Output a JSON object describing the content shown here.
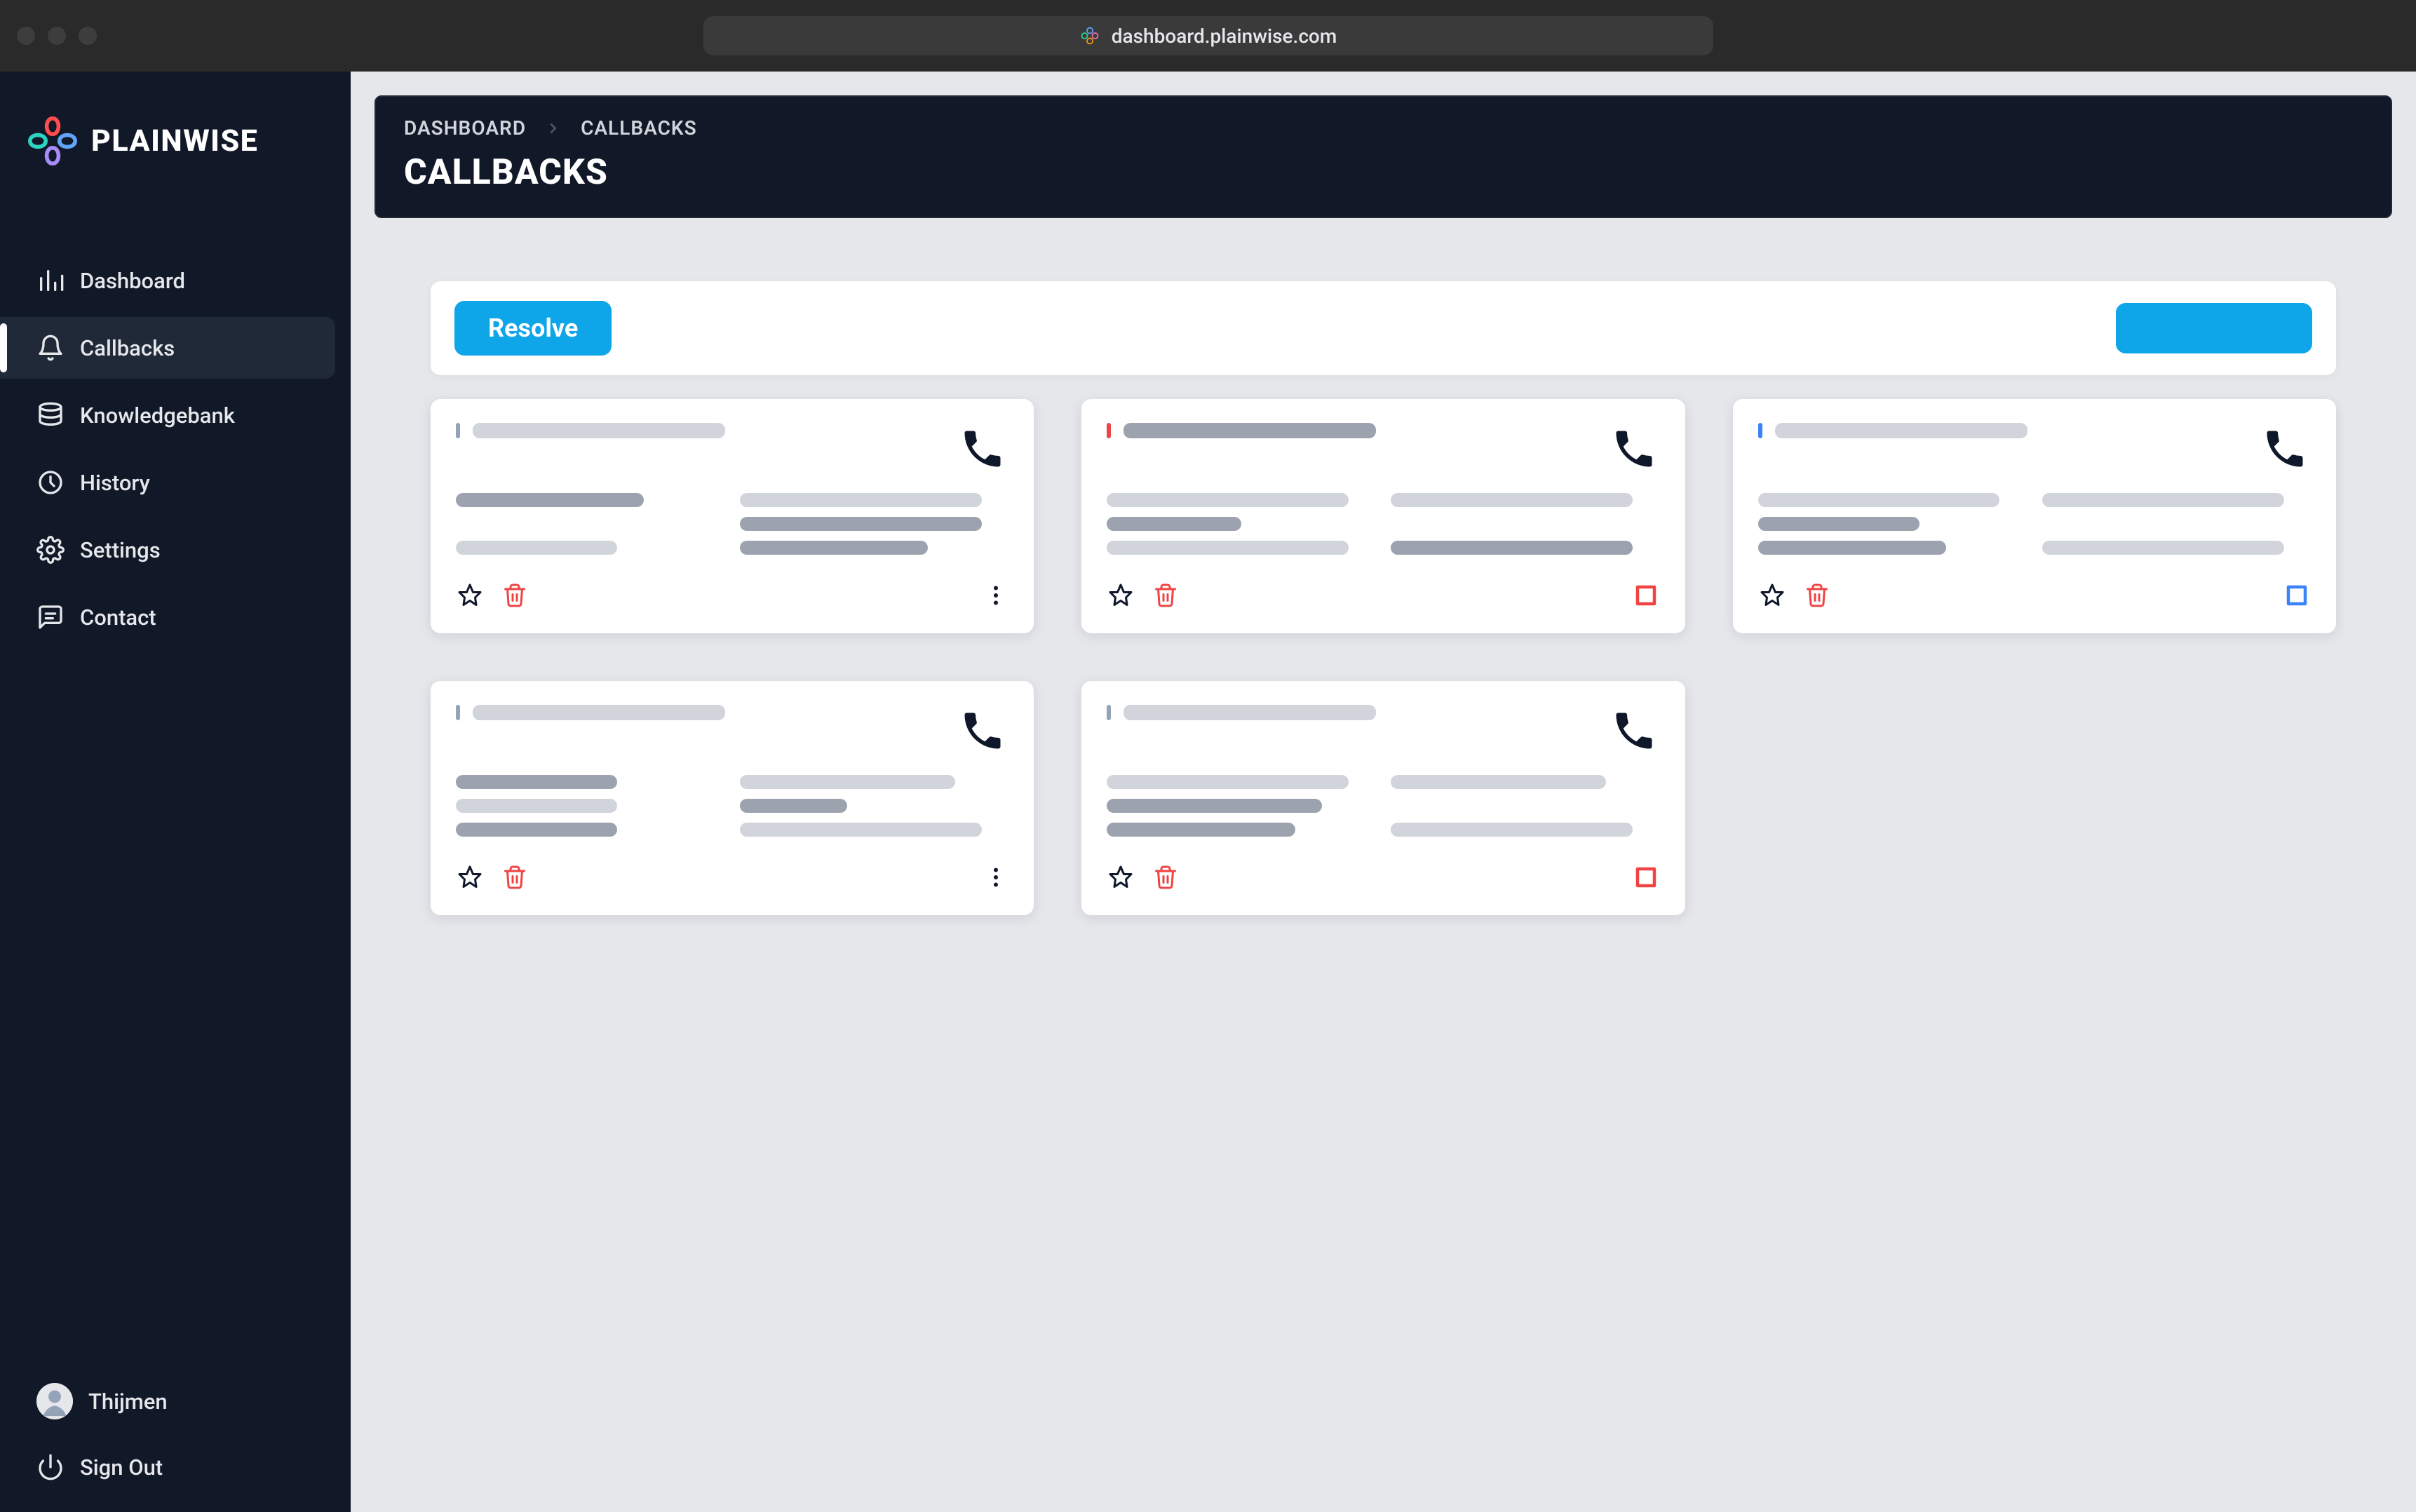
{
  "chrome": {
    "url": "dashboard.plainwise.com"
  },
  "brand": {
    "name": "PLAINWISE"
  },
  "sidebar": {
    "items": [
      {
        "icon": "chart-bar",
        "label": "Dashboard",
        "active": false
      },
      {
        "icon": "bell",
        "label": "Callbacks",
        "active": true
      },
      {
        "icon": "database",
        "label": "Knowledgebank",
        "active": false
      },
      {
        "icon": "clock",
        "label": "History",
        "active": false
      },
      {
        "icon": "gear",
        "label": "Settings",
        "active": false
      },
      {
        "icon": "chat",
        "label": "Contact",
        "active": false
      }
    ],
    "user": {
      "name": "Thijmen"
    },
    "signout_label": "Sign Out"
  },
  "header": {
    "breadcrumbs": [
      "DASHBOARD",
      "CALLBACKS"
    ],
    "title": "CALLBACKS"
  },
  "toolbar": {
    "resolve_label": "Resolve"
  },
  "cards": [
    {
      "accent": "gray",
      "right_action": "more"
    },
    {
      "accent": "red",
      "right_action": "select-red"
    },
    {
      "accent": "blue",
      "right_action": "select-blue"
    },
    {
      "accent": "gray",
      "right_action": "more"
    },
    {
      "accent": "gray",
      "right_action": "select-red"
    }
  ]
}
